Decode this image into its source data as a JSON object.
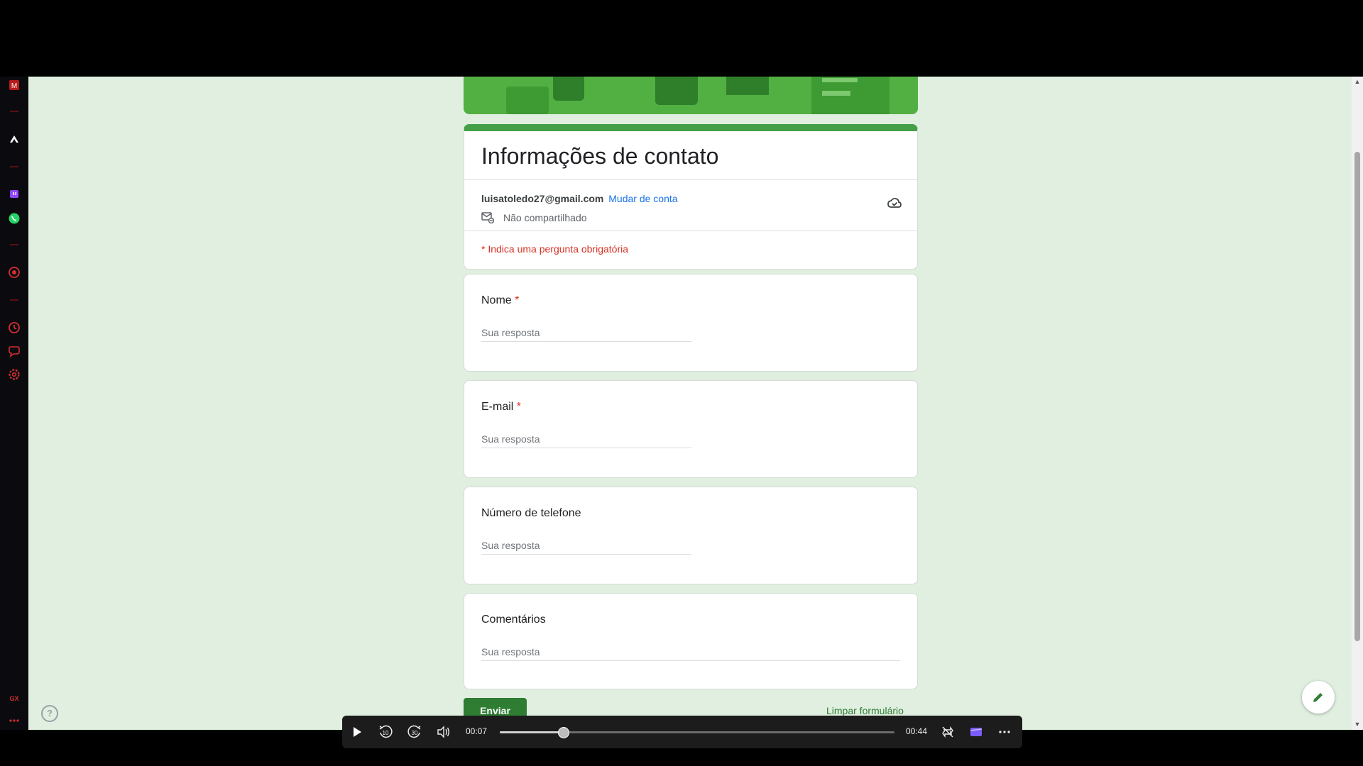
{
  "form": {
    "title": "Informações de contato",
    "account_email": "luisatoledo27@gmail.com",
    "switch_account": "Mudar de conta",
    "not_shared": "Não compartilhado",
    "required_note": "* Indica uma pergunta obrigatória",
    "questions": [
      {
        "label": "Nome",
        "required": "*",
        "placeholder": "Sua resposta"
      },
      {
        "label": "E-mail",
        "required": "*",
        "placeholder": "Sua resposta"
      },
      {
        "label": "Número de telefone",
        "required": "",
        "placeholder": "Sua resposta"
      },
      {
        "label": "Comentários",
        "required": "",
        "placeholder": "Sua resposta"
      }
    ],
    "submit_label": "Enviar",
    "clear_label": "Limpar formulário",
    "help_symbol": "?",
    "theme_color": "#43a047",
    "background_color": "#e0efe0"
  },
  "player": {
    "current_time": "00:07",
    "duration": "00:44",
    "progress_fraction": 0.16,
    "rewind_label": "10",
    "forward_label": "30"
  },
  "icons": {
    "rail": [
      "app-icon-m",
      "separator",
      "arrow-up-icon",
      "separator",
      "twitch-icon",
      "whatsapp-icon",
      "separator",
      "record-icon",
      "separator",
      "history-icon",
      "chat-icon",
      "settings-icon",
      "gx-icon",
      "more-icon"
    ],
    "form": [
      "share-off-icon",
      "cloud-icon",
      "help-icon",
      "pencil-icon"
    ],
    "player": [
      "play-icon",
      "rewind-10-icon",
      "forward-30-icon",
      "volume-icon",
      "loop-icon",
      "clipchamp-icon",
      "more-icon"
    ]
  }
}
